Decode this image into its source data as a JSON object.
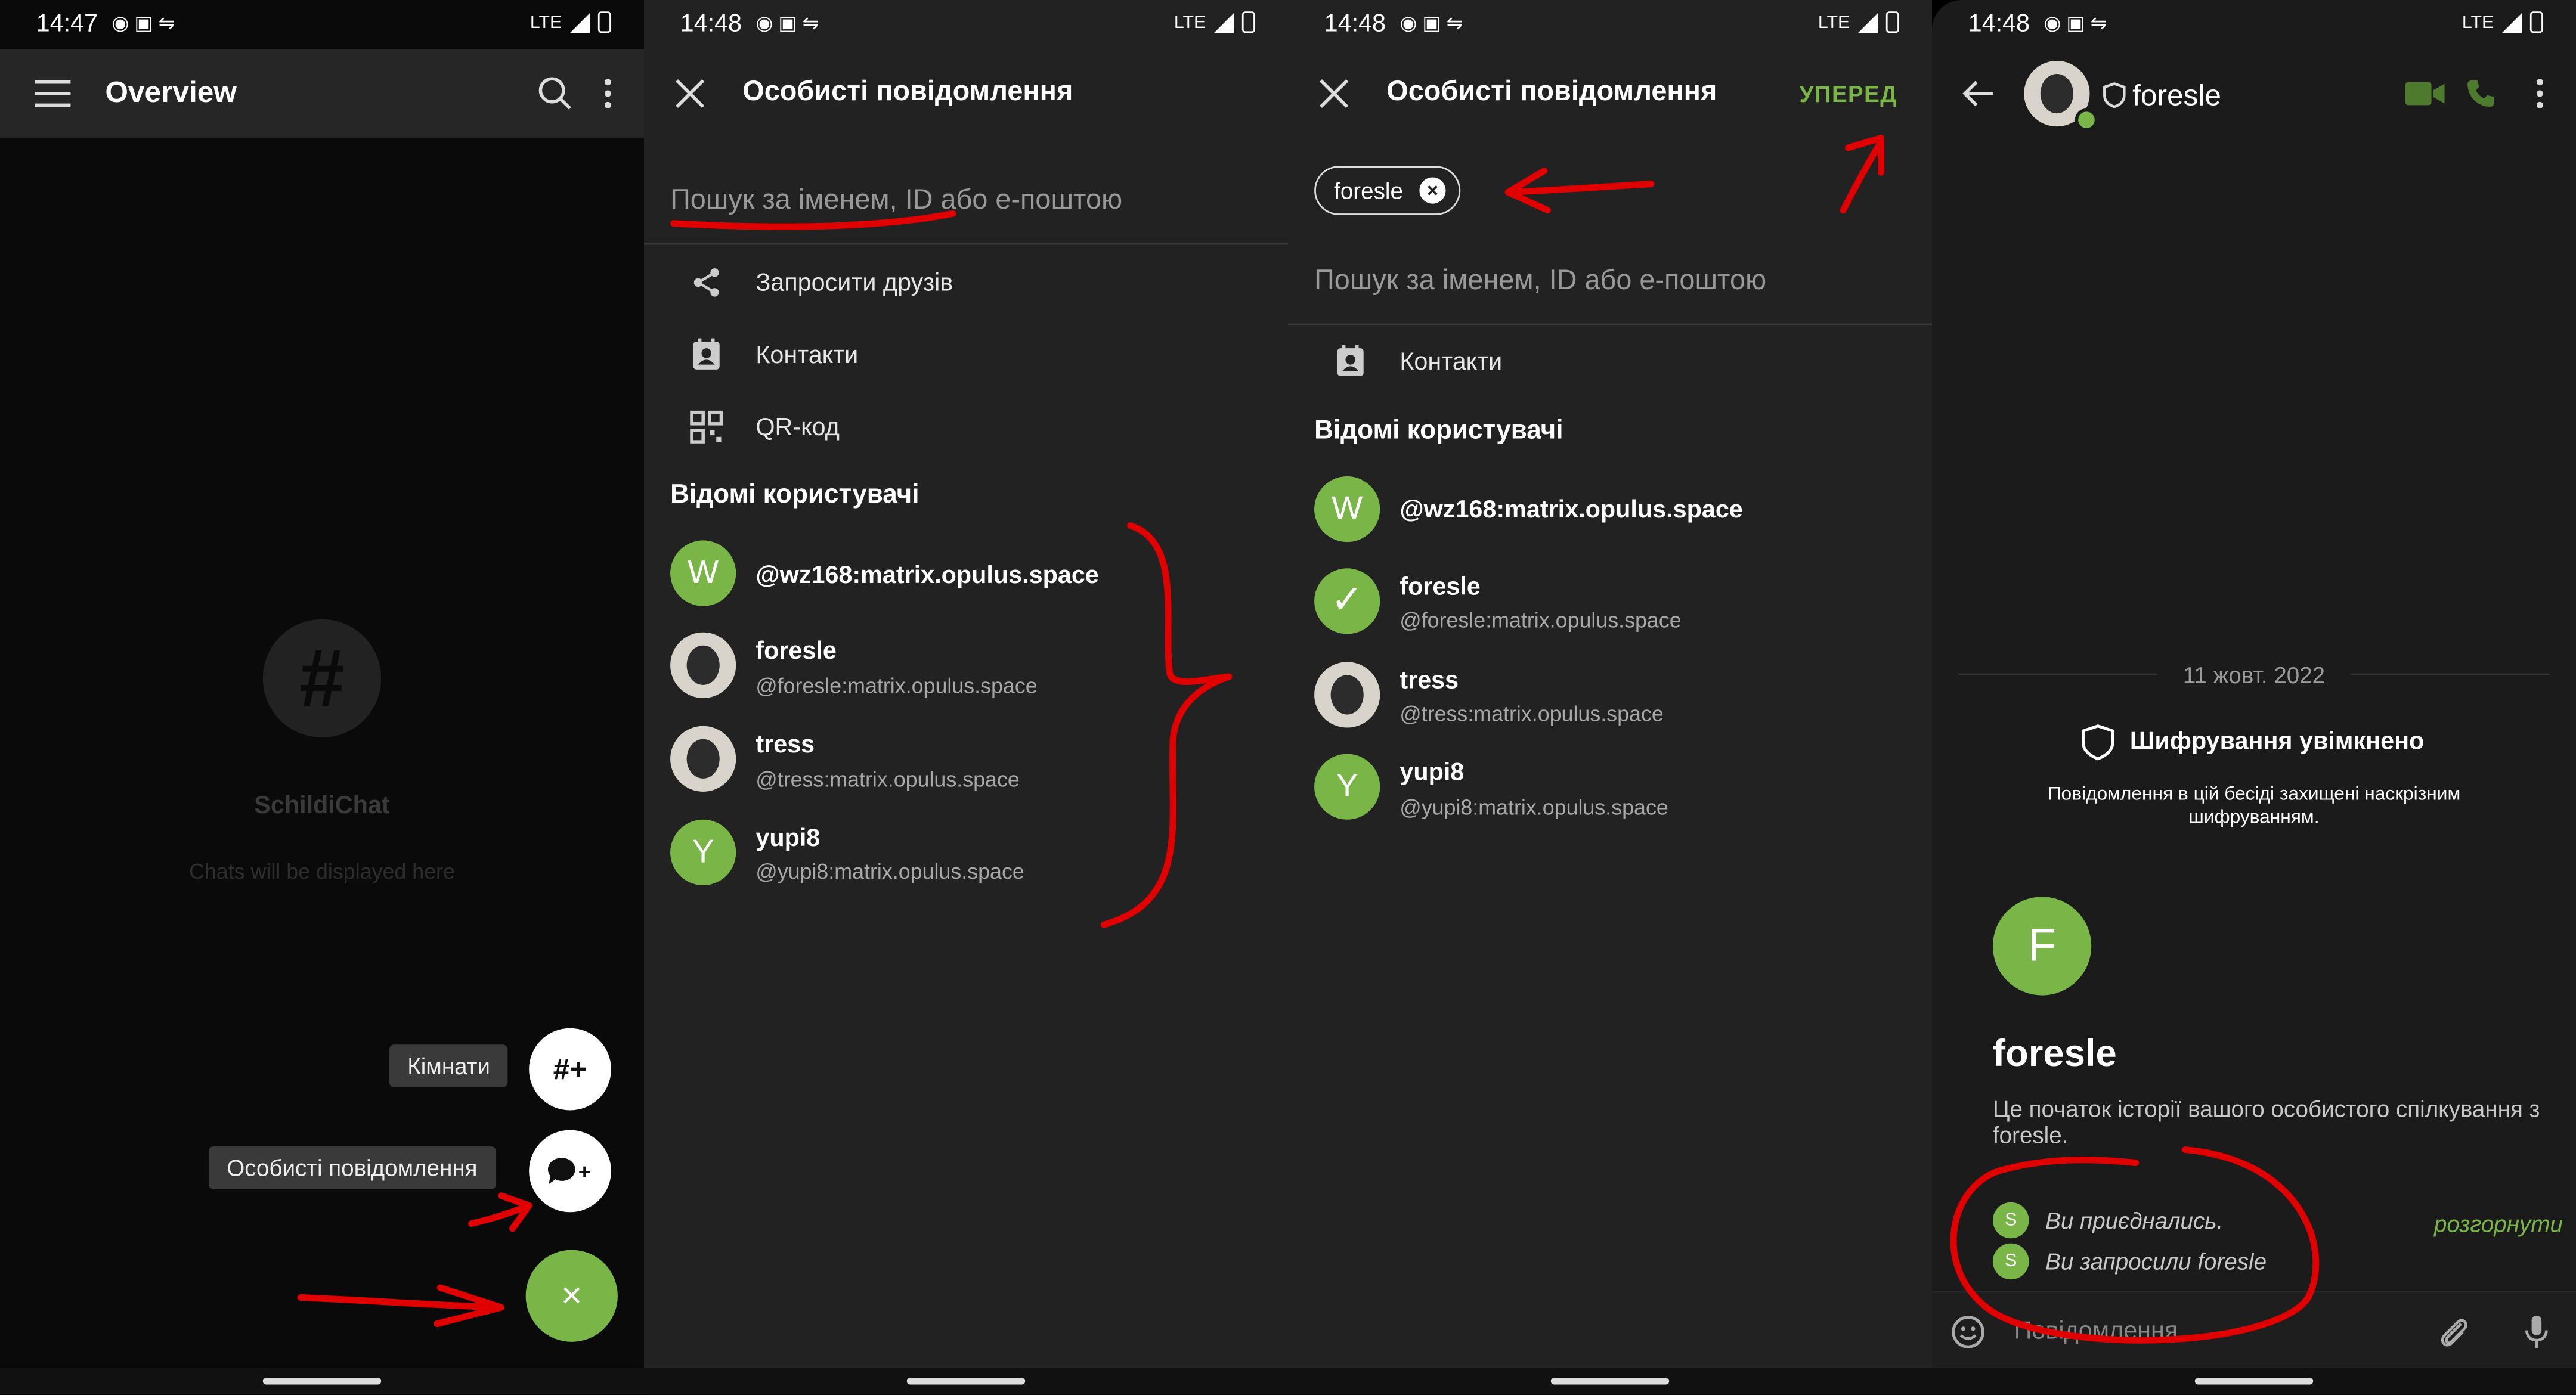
{
  "s1": {
    "time": "14:47",
    "net": "LTE",
    "title": "Overview",
    "empty_title": "SchildiChat",
    "empty_sub": "Chats will be displayed here",
    "fab_rooms_label": "Кімнати",
    "fab_dm_label": "Особисті повідомлення",
    "fab_rooms_icon": "#+",
    "fab_close": "×"
  },
  "s2": {
    "time": "14:48",
    "net": "LTE",
    "title": "Особисті повідомлення",
    "search_placeholder": "Пошук за іменем, ID або е-поштою",
    "actions": [
      {
        "label": "Запросити друзів",
        "icon": "share-icon"
      },
      {
        "label": "Контакти",
        "icon": "contacts-icon"
      },
      {
        "label": "QR-код",
        "icon": "qr-code-icon"
      }
    ],
    "section": "Відомі користувачі",
    "users": [
      {
        "avatar": "W",
        "name": "@wz168:matrix.opulus.space",
        "id": ""
      },
      {
        "avatar": "",
        "name": "foresle",
        "id": "@foresle:matrix.opulus.space"
      },
      {
        "avatar": "",
        "name": "tress",
        "id": "@tress:matrix.opulus.space"
      },
      {
        "avatar": "Y",
        "name": "yupi8",
        "id": "@yupi8:matrix.opulus.space"
      }
    ]
  },
  "s3": {
    "time": "14:48",
    "net": "LTE",
    "title": "Особисті повідомлення",
    "next": "УПЕРЕД",
    "chip": "foresle",
    "search_placeholder": "Пошук за іменем, ID або е-поштою",
    "contacts": "Контакти",
    "section": "Відомі користувачі",
    "users": [
      {
        "avatar": "W",
        "name": "@wz168:matrix.opulus.space",
        "id": ""
      },
      {
        "avatar": "✓",
        "name": "foresle",
        "id": "@foresle:matrix.opulus.space"
      },
      {
        "avatar": "",
        "name": "tress",
        "id": "@tress:matrix.opulus.space"
      },
      {
        "avatar": "Y",
        "name": "yupi8",
        "id": "@yupi8:matrix.opulus.space"
      }
    ]
  },
  "s4": {
    "time": "14:48",
    "net": "LTE",
    "room": "foresle",
    "date": "11 жовт. 2022",
    "enc_title": "Шифрування увімкнено",
    "enc_desc": "Повідомлення в цій бесіді захищені наскрізним шифруванням.",
    "avatar": "F",
    "name": "foresle",
    "start": "Це початок історії вашого особистого спілкування з foresle.",
    "events": [
      {
        "avatar": "S",
        "text": "Ви приєднались."
      },
      {
        "avatar": "S",
        "text": "Ви запросили foresle"
      }
    ],
    "expand": "розгорнути",
    "composer_placeholder": "Повідомлення…"
  },
  "colors": {
    "accent": "#79b647",
    "annotation": "#e00000"
  }
}
